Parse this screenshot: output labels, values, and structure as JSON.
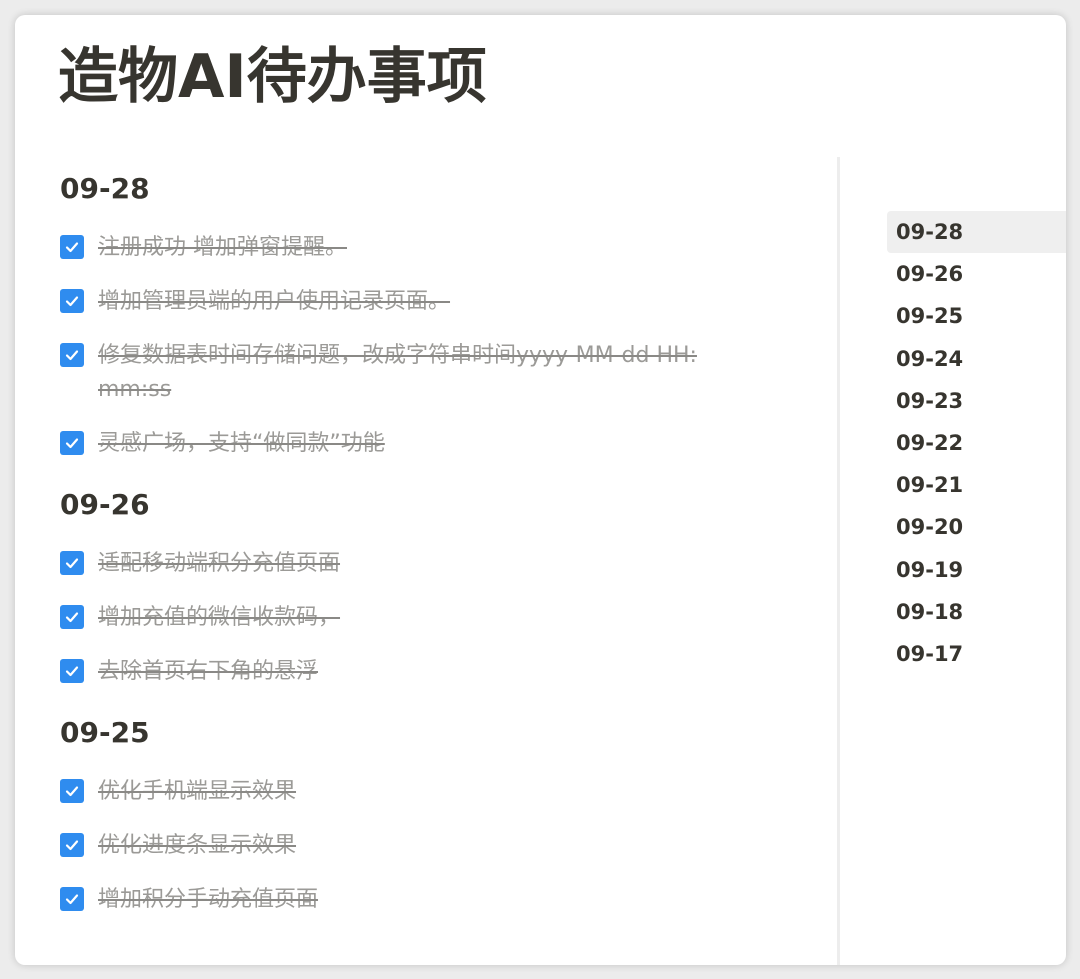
{
  "title": "造物AI待办事项",
  "sections": [
    {
      "date": "09-28",
      "items": [
        {
          "text": "注册成功 增加弹窗提醒。",
          "done": true
        },
        {
          "text": "增加管理员端的用户使用记录页面。",
          "done": true
        },
        {
          "text": "修复数据表时间存储问题，改成字符串时间yyyy-MM-dd HH:mm:ss",
          "done": true
        },
        {
          "text": "灵感广场，支持“做同款”功能",
          "done": true
        }
      ]
    },
    {
      "date": "09-26",
      "items": [
        {
          "text": "适配移动端积分充值页面",
          "done": true
        },
        {
          "text": "增加充值的微信收款码，",
          "done": true
        },
        {
          "text": "去除首页右下角的悬浮",
          "done": true
        }
      ]
    },
    {
      "date": "09-25",
      "items": [
        {
          "text": "优化手机端显示效果",
          "done": true
        },
        {
          "text": "优化进度条显示效果",
          "done": true
        },
        {
          "text": "增加积分手动充值页面",
          "done": true
        }
      ]
    }
  ],
  "toc": {
    "active": "09-28",
    "items": [
      "09-28",
      "09-26",
      "09-25",
      "09-24",
      "09-23",
      "09-22",
      "09-21",
      "09-20",
      "09-19",
      "09-18",
      "09-17"
    ]
  },
  "colors": {
    "checkbox": "#2f8cef",
    "text_done": "#9b9a97",
    "heading": "#37352f"
  }
}
